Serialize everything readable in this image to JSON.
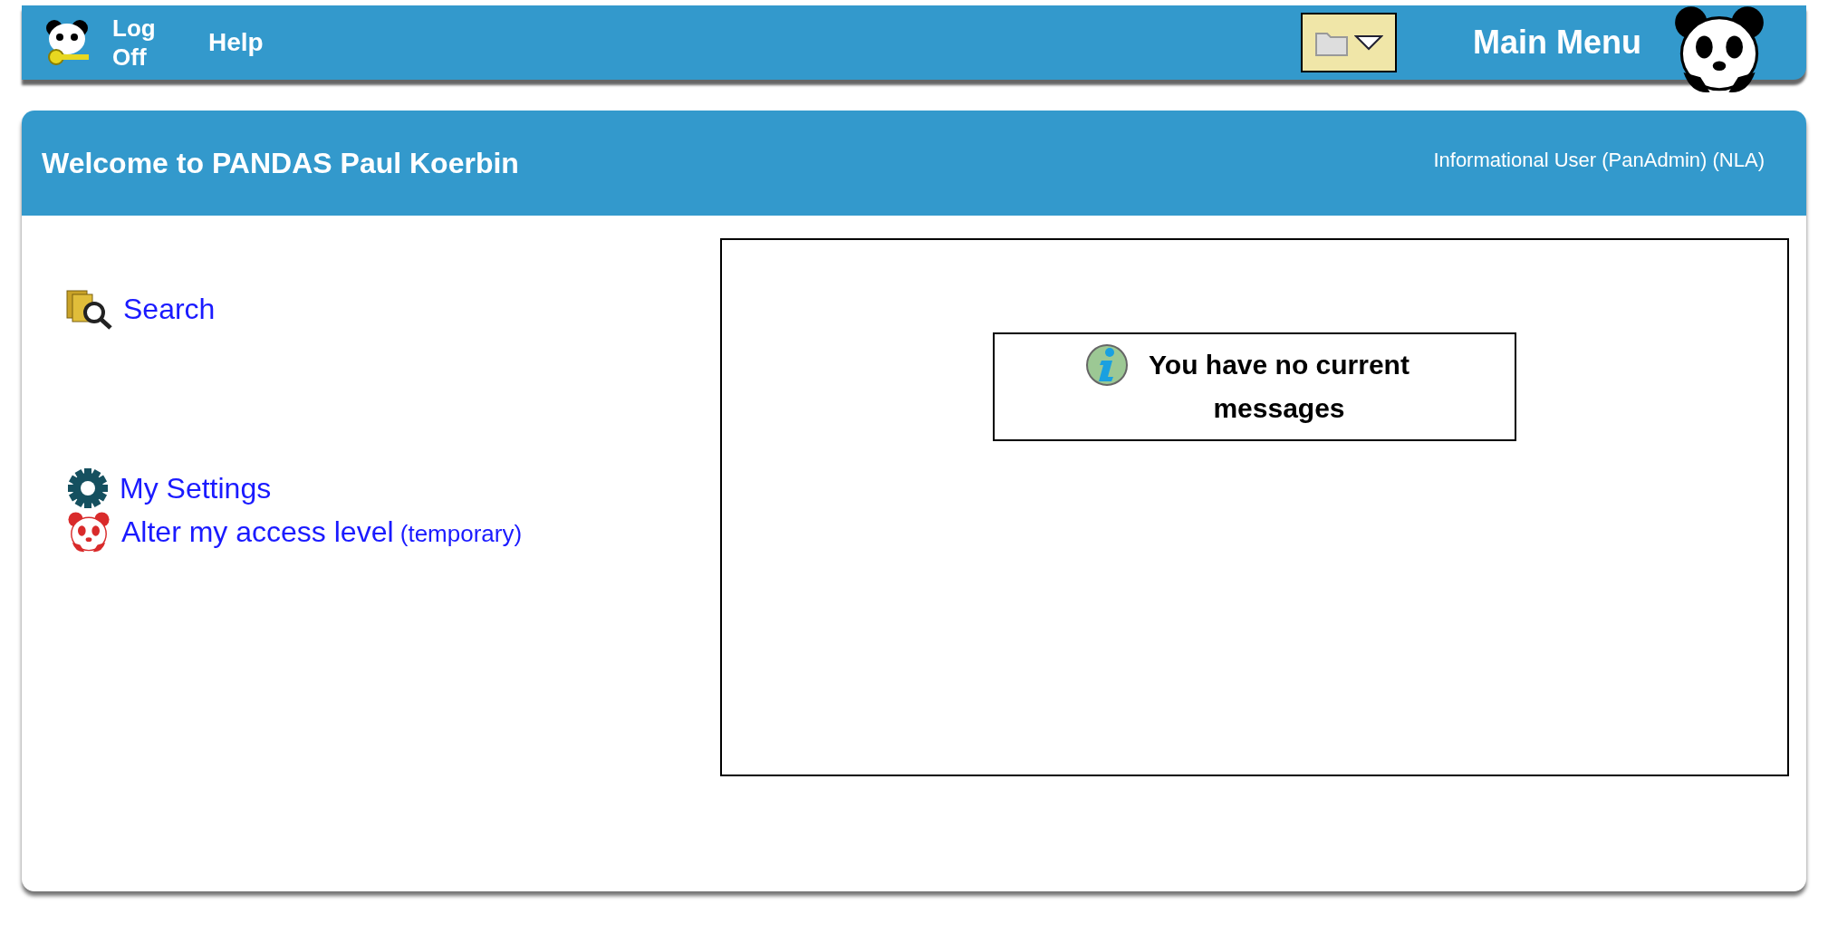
{
  "top_bar": {
    "log_off": "Log Off",
    "help": "Help",
    "main_menu": "Main Menu"
  },
  "header": {
    "welcome": "Welcome to PANDAS Paul Koerbin",
    "user_info": "Informational User (PanAdmin) (NLA)"
  },
  "links": [
    {
      "kind": "search",
      "label": "Search"
    },
    {
      "kind": "settings",
      "label": "My Settings"
    },
    {
      "kind": "access",
      "label": "Alter my access level",
      "note": "(temporary)"
    }
  ],
  "messages": {
    "text": "You have no current messages"
  }
}
